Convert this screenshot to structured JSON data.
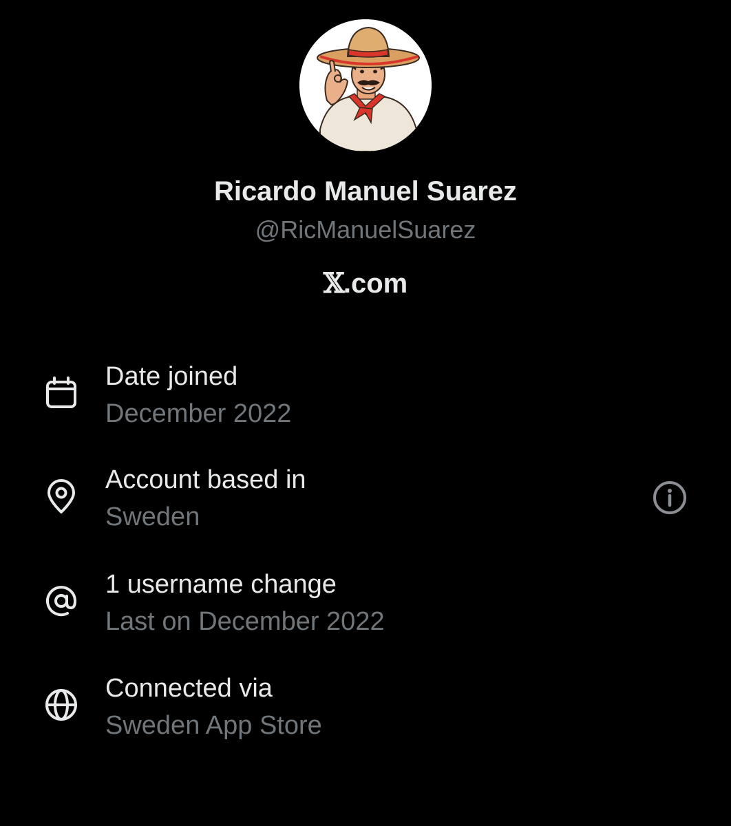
{
  "profile": {
    "display_name": "Ricardo Manuel Suarez",
    "handle": "@RicManuelSuarez",
    "site_logo_glyph": "𝕏",
    "site_suffix": ".com"
  },
  "rows": [
    {
      "icon": "calendar-icon",
      "label": "Date joined",
      "value": "December 2022"
    },
    {
      "icon": "location-pin-icon",
      "label": "Account based in",
      "value": "Sweden",
      "has_info": true
    },
    {
      "icon": "at-sign-icon",
      "label": "1 username change",
      "value": "Last on December 2022"
    },
    {
      "icon": "globe-icon",
      "label": "Connected via",
      "value": "Sweden App Store"
    }
  ],
  "colors": {
    "background": "#000000",
    "primary_text": "#e7e9ea",
    "secondary_text": "#71767b",
    "icon_muted": "#8b8f94"
  }
}
